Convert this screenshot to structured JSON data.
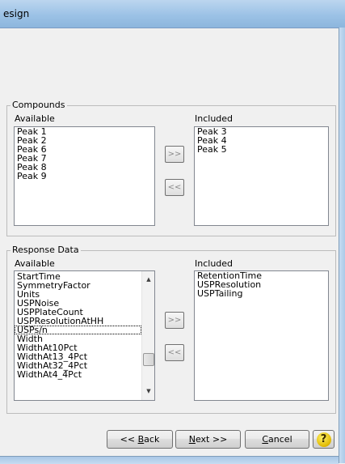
{
  "window": {
    "title": "esign"
  },
  "compounds": {
    "group_label": "Compounds",
    "available_label": "Available",
    "included_label": "Included",
    "available": [
      "Peak 1",
      "Peak 2",
      "Peak 6",
      "Peak 7",
      "Peak 8",
      "Peak 9"
    ],
    "included": [
      "Peak 3",
      "Peak 4",
      "Peak 5"
    ],
    "add_label": ">>",
    "remove_label": "<<"
  },
  "response": {
    "group_label": "Response Data",
    "available_label": "Available",
    "included_label": "Included",
    "available": [
      "StartTime",
      "SymmetryFactor",
      "Units",
      "USPNoise",
      "USPPlateCount",
      "USPResolutionAtHH",
      "USPs/n",
      "Width",
      "WidthAt10Pct",
      "WidthAt13_4Pct",
      "WidthAt32_4Pct",
      "WidthAt4_4Pct"
    ],
    "focused_item": "USPs/n",
    "included": [
      "RetentionTime",
      "USPResolution",
      "USPTailing"
    ],
    "add_label": ">>",
    "remove_label": "<<",
    "scroll_position": 0.8
  },
  "buttons": {
    "back_prefix": "<< ",
    "back_key": "B",
    "back_rest": "ack",
    "next_key": "N",
    "next_rest": "ext >>",
    "cancel_key": "C",
    "cancel_rest": "ancel",
    "help_icon": "help-question-icon",
    "help_glyph": "?"
  },
  "colors": {
    "title_bar": "#9cc2e6",
    "dialog_bg": "#f0f0f0",
    "list_bg": "#ffffff",
    "help_icon": "#e0b800"
  }
}
